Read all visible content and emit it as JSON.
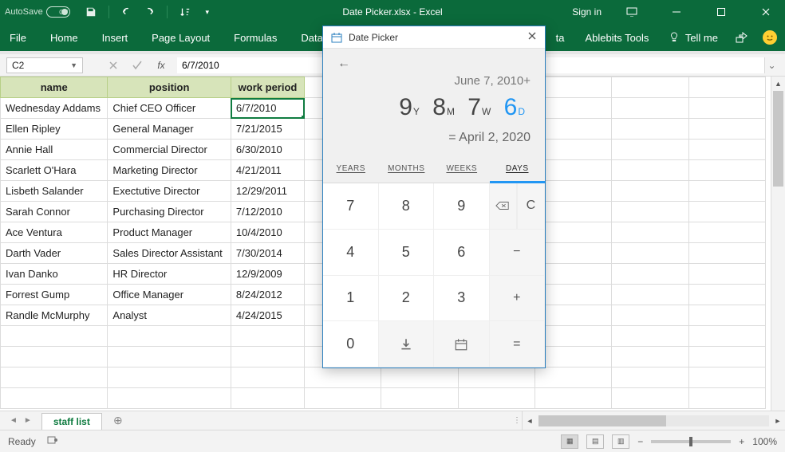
{
  "titlebar": {
    "autosave_label": "AutoSave",
    "autosave_state": "Off",
    "title": "Date Picker.xlsx - Excel",
    "signin": "Sign in"
  },
  "ribbon": {
    "tabs": [
      "File",
      "Home",
      "Insert",
      "Page Layout",
      "Formulas",
      "Data"
    ],
    "right": {
      "truncated_tab_suffix": "ta",
      "ablebits": "Ablebits Tools",
      "tellme": "Tell me"
    }
  },
  "formula": {
    "namebox": "C2",
    "fx_label": "fx",
    "value": "6/7/2010"
  },
  "sheet": {
    "headers": {
      "name": "name",
      "position": "position",
      "work_period": "work period"
    },
    "rows": [
      {
        "name": "Wednesday Addams",
        "position": "Chief CEO Officer",
        "date": "6/7/2010"
      },
      {
        "name": "Ellen Ripley",
        "position": "General Manager",
        "date": "7/21/2015"
      },
      {
        "name": "Annie Hall",
        "position": "Commercial Director",
        "date": "6/30/2010"
      },
      {
        "name": "Scarlett O'Hara",
        "position": "Marketing Director",
        "date": "4/21/2011"
      },
      {
        "name": "Lisbeth Salander",
        "position": "Exectutive Director",
        "date": "12/29/2011"
      },
      {
        "name": "Sarah Connor",
        "position": "Purchasing Director",
        "date": "7/12/2010"
      },
      {
        "name": "Ace Ventura",
        "position": "Product Manager",
        "date": "10/4/2010"
      },
      {
        "name": "Darth Vader",
        "position": "Sales Director Assistant",
        "date": "7/30/2014"
      },
      {
        "name": "Ivan Danko",
        "position": "HR Director",
        "date": "12/9/2009"
      },
      {
        "name": "Forrest Gump",
        "position": "Office Manager",
        "date": "8/24/2012"
      },
      {
        "name": "Randle McMurphy",
        "position": "Analyst",
        "date": "4/24/2015"
      }
    ],
    "tab_name": "staff list"
  },
  "status": {
    "ready": "Ready",
    "zoom": "100%"
  },
  "picker": {
    "title": "Date Picker",
    "anchor_date": "June 7, 2010+",
    "big": {
      "y_val": "9",
      "y_unit": "Y",
      "m_val": "8",
      "m_unit": "M",
      "w_val": "7",
      "w_unit": "W",
      "d_val": "6",
      "d_unit": "D"
    },
    "result": "= April 2, 2020",
    "tabs": {
      "years": "YEARS",
      "months": "MONTHS",
      "weeks": "WEEKS",
      "days": "DAYS"
    },
    "keys": {
      "k7": "7",
      "k8": "8",
      "k9": "9",
      "clear": "C",
      "k4": "4",
      "k5": "5",
      "k6": "6",
      "minus": "−",
      "k1": "1",
      "k2": "2",
      "k3": "3",
      "plus": "+",
      "k0": "0",
      "equals": "="
    }
  }
}
